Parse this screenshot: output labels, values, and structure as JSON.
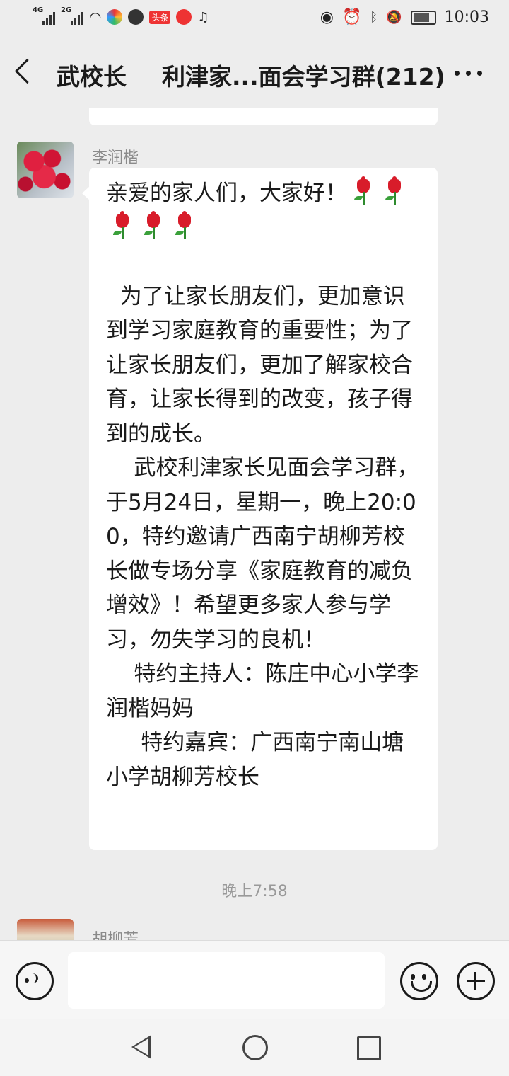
{
  "status_bar": {
    "network1": "4G",
    "network2": "2G",
    "app_badge": "头条",
    "time": "10:03",
    "icons": [
      "signal-icon",
      "wifi-icon",
      "app-icon",
      "notification-icon",
      "eye-icon",
      "alarm-icon",
      "bluetooth-icon",
      "mute-icon",
      "battery-icon"
    ]
  },
  "header": {
    "back_label": "",
    "contact": "武校长",
    "group_title": "利津家...面会学习群(212)"
  },
  "messages": [
    {
      "sender": "李润楷",
      "avatar": "red-roses",
      "line1": "亲爱的家人们，大家好！",
      "body": "\n  为了让家长朋友们，更加意识到学习家庭教育的重要性；为了让家长朋友们，更加了解家校合育，让家长得到的改变，孩子得到的成长。\n    武校利津家长见面会学习群，于5月24日，星期一，晚上20:00，特约邀请广西南宁胡柳芳校长做专场分享《家庭教育的减负增效》！希望更多家人参与学习，勿失学习的良机！\n    特约主持人：陈庄中心小学李润楷妈妈\n     特约嘉宾：广西南宁南山塘小学胡柳芳校长",
      "emoji": "tulip",
      "emoji_count": 5
    }
  ],
  "timestamp": "晚上7:58",
  "next_sender": "胡柳芳",
  "input": {
    "placeholder": "",
    "value": ""
  },
  "colors": {
    "background": "#ededed",
    "bubble": "#ffffff",
    "sender": "#8a8a8a",
    "timestamp": "#999999"
  }
}
